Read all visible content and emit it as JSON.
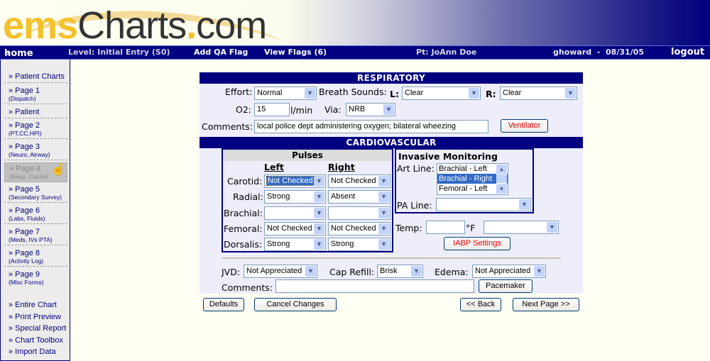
{
  "header": {
    "logo": {
      "part1": "ems",
      "part2": "Charts",
      "part3": ".",
      "part4": "com"
    }
  },
  "navbar": {
    "home_icon": "double-chevron-right",
    "home": "home",
    "level": "Level: Initial Entry (S0)",
    "add_qa_flag": "Add QA Flag",
    "view_flags": "View Flags (6)",
    "patient": "Pt: JoAnn Doe",
    "user_date": "ghoward  -  08/31/05",
    "logout": "logout"
  },
  "sidebar": {
    "items": [
      {
        "label": "» Patient Charts",
        "sub": ""
      },
      {
        "label": "» Page 1",
        "sub": "(Dispatch)"
      },
      {
        "label": "» Patient",
        "sub": ""
      },
      {
        "label": "» Page 2",
        "sub": "(PT,CC,HPI)"
      },
      {
        "label": "» Page 3",
        "sub": "(Neuro, Airway)"
      },
      {
        "label": "» Page 4",
        "sub": "(Resp, Cardio)",
        "active": true
      },
      {
        "label": "» Page 5",
        "sub": "(Secondary Survey)"
      },
      {
        "label": "» Page 6",
        "sub": "(Labs, Fluids)"
      },
      {
        "label": "» Page 7",
        "sub": "(Meds, IVs PTA)"
      },
      {
        "label": "» Page 8",
        "sub": "(Activity Log)"
      },
      {
        "label": "» Page 9",
        "sub": "(Misc Forms)"
      }
    ],
    "links": [
      "» Entire Chart",
      "» Print Preview",
      "» Special Report",
      "» Chart Toolbox",
      "» Import Data"
    ]
  },
  "respiratory": {
    "title": "RESPIRATORY",
    "effort_label": "Effort:",
    "effort_value": "Normal",
    "breath_sounds_label": "Breath Sounds:",
    "left_label": "L:",
    "left_value": "Clear",
    "right_label": "R:",
    "right_value": "Clear",
    "o2_label": "O2:",
    "o2_value": "15",
    "o2_unit": "l/min",
    "via_label": "Via:",
    "via_value": "NRB",
    "comments_label": "Comments:",
    "comments_value": "local police dept administering oxygen; bilateral wheezing",
    "ventilator_button": "Ventilator"
  },
  "cardiovascular": {
    "title": "CARDIOVASCULAR",
    "pulses": {
      "title": "Pulses",
      "left_header": "Left",
      "right_header": "Right",
      "rows": [
        {
          "label": "Carotid:",
          "left": "Not Checked",
          "right": "Not Checked"
        },
        {
          "label": "Radial:",
          "left": "Strong",
          "right": "Absent"
        },
        {
          "label": "Brachial:",
          "left": "",
          "right": ""
        },
        {
          "label": "Femoral:",
          "left": "Not Checked",
          "right": "Not Checked"
        },
        {
          "label": "Dorsalis:",
          "left": "Strong",
          "right": "Strong"
        }
      ]
    },
    "invasive": {
      "title": "Invasive Monitoring",
      "art_line_label": "Art Line:",
      "art_line_options": [
        "Brachial - Left",
        "Brachial - Right",
        "Femoral - Left"
      ],
      "art_line_selected": "Brachial - Right",
      "pa_line_label": "PA Line:",
      "pa_line_value": ""
    },
    "temp_label": "Temp:",
    "temp_value": "",
    "temp_unit": "°F",
    "temp_site_value": "",
    "iabp_button": "IABP Settings",
    "jvd_label": "JVD:",
    "jvd_value": "Not Appreciated",
    "cap_refill_label": "Cap Refill:",
    "cap_refill_value": "Brisk",
    "edema_label": "Edema:",
    "edema_value": "Not Appreciated",
    "comments_label": "Comments:",
    "comments_value": "",
    "pacemaker_button": "Pacemaker"
  },
  "footer": {
    "defaults": "Defaults",
    "cancel": "Cancel Changes",
    "back": "<< Back",
    "next": "Next Page >>"
  }
}
